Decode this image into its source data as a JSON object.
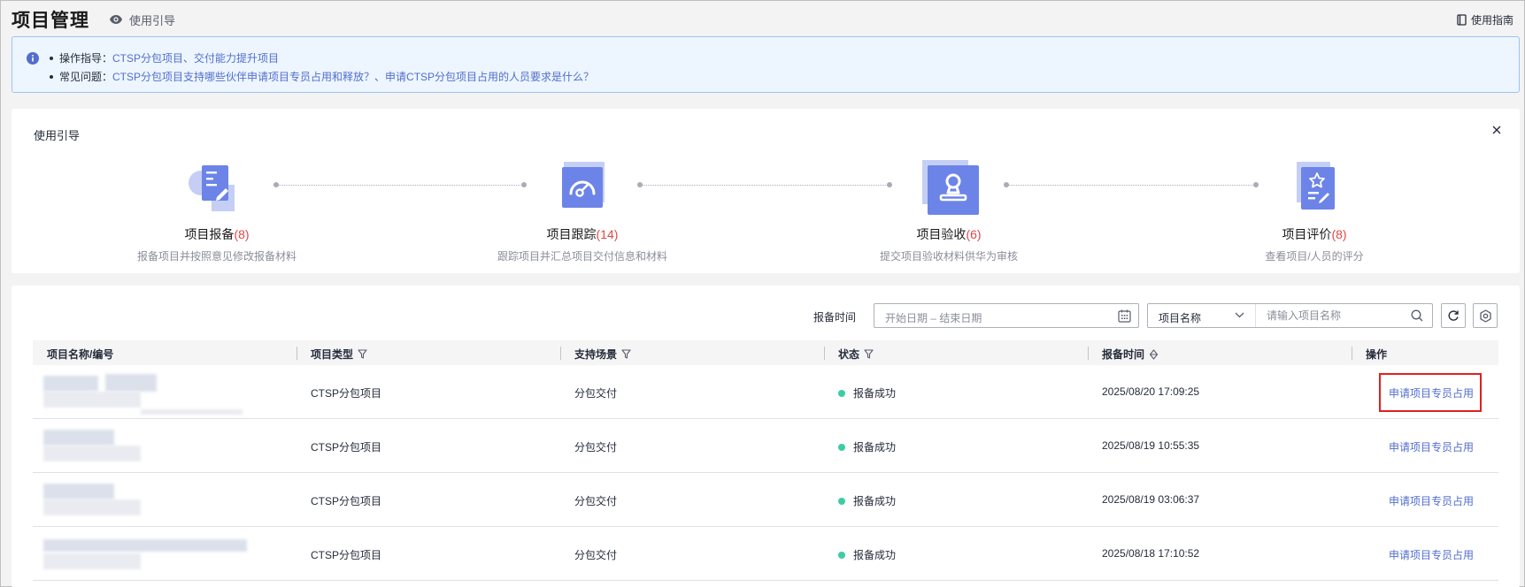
{
  "header": {
    "title": "项目管理",
    "guide_toggle": "使用引导",
    "manual": "使用指南"
  },
  "banner": {
    "line1": {
      "prefix": "操作指导：",
      "link": "CTSP分包项目、交付能力提升项目"
    },
    "line2": {
      "prefix": "常见问题：",
      "link1": "CTSP分包项目支持哪些伙伴申请项目专员占用和释放？",
      "separator": "、",
      "link2": "申请CTSP分包项目占用的人员要求是什么？"
    }
  },
  "guide": {
    "title": "使用引导",
    "steps": [
      {
        "name": "项目报备",
        "count": "(8)",
        "desc": "报备项目并按照意见修改报备材料",
        "icon": "document-edit-icon"
      },
      {
        "name": "项目跟踪",
        "count": "(14)",
        "desc": "跟踪项目并汇总项目交付信息和材料",
        "icon": "gauge-icon"
      },
      {
        "name": "项目验收",
        "count": "(6)",
        "desc": "提交项目验收材料供华为审核",
        "icon": "stamp-icon"
      },
      {
        "name": "项目评价",
        "count": "(8)",
        "desc": "查看项目/人员的评分",
        "icon": "star-document-icon"
      }
    ]
  },
  "filters": {
    "date_label": "报备时间",
    "date_placeholder": "开始日期 – 结束日期",
    "search_field": "项目名称",
    "search_placeholder": "请输入项目名称"
  },
  "table": {
    "columns": [
      "项目名称/编号",
      "项目类型",
      "支持场景",
      "状态",
      "报备时间",
      "操作"
    ],
    "rows": [
      {
        "type": "CTSP分包项目",
        "scene": "分包交付",
        "status": "报备成功",
        "time": "2025/08/20 17:09:25",
        "action": "申请项目专员占用"
      },
      {
        "type": "CTSP分包项目",
        "scene": "分包交付",
        "status": "报备成功",
        "time": "2025/08/19 10:55:35",
        "action": "申请项目专员占用"
      },
      {
        "type": "CTSP分包项目",
        "scene": "分包交付",
        "status": "报备成功",
        "time": "2025/08/19 03:06:37",
        "action": "申请项目专员占用"
      },
      {
        "type": "CTSP分包项目",
        "scene": "分包交付",
        "status": "报备成功",
        "time": "2025/08/18 17:10:52",
        "action": "申请项目专员占用"
      }
    ]
  },
  "colors": {
    "accent": "#526ecc",
    "count": "#e54545",
    "status_success": "#3dcca6",
    "highlight": "#e02020"
  }
}
